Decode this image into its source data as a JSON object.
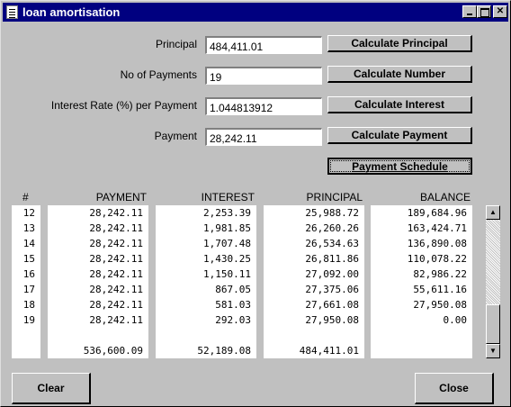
{
  "window": {
    "title": "loan amortisation"
  },
  "form": {
    "principal": {
      "label": "Principal",
      "value": "484,411.01",
      "button": "Calculate Principal"
    },
    "payments": {
      "label": "No of Payments",
      "value": "19",
      "button": "Calculate Number"
    },
    "interest": {
      "label": "Interest Rate (%) per Payment",
      "value": "1.044813912",
      "button": "Calculate Interest"
    },
    "payment": {
      "label": "Payment",
      "value": "28,242.11",
      "button": "Calculate Payment"
    },
    "schedule_button": "Payment Schedule"
  },
  "table": {
    "headers": [
      "#",
      "PAYMENT",
      "INTEREST",
      "PRINCIPAL",
      "BALANCE"
    ],
    "rows": [
      [
        "12",
        "28,242.11",
        "2,253.39",
        "25,988.72",
        "189,684.96"
      ],
      [
        "13",
        "28,242.11",
        "1,981.85",
        "26,260.26",
        "163,424.71"
      ],
      [
        "14",
        "28,242.11",
        "1,707.48",
        "26,534.63",
        "136,890.08"
      ],
      [
        "15",
        "28,242.11",
        "1,430.25",
        "26,811.86",
        "110,078.22"
      ],
      [
        "16",
        "28,242.11",
        "1,150.11",
        "27,092.00",
        "82,986.22"
      ],
      [
        "17",
        "28,242.11",
        "867.05",
        "27,375.06",
        "55,611.16"
      ],
      [
        "18",
        "28,242.11",
        "581.03",
        "27,661.08",
        "27,950.08"
      ],
      [
        "19",
        "28,242.11",
        "292.03",
        "27,950.08",
        "0.00"
      ]
    ],
    "totals": {
      "payment": "536,600.09",
      "interest": "52,189.08",
      "principal": "484,411.01"
    }
  },
  "buttons": {
    "clear": "Clear",
    "close": "Close"
  }
}
